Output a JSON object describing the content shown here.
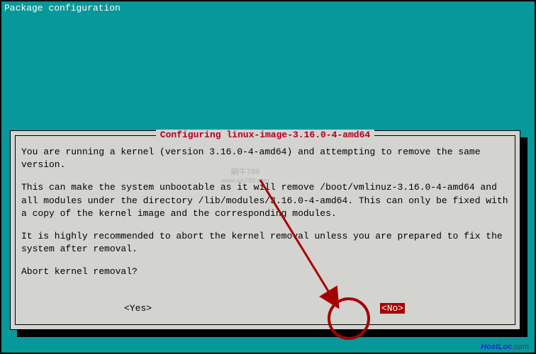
{
  "header": {
    "title": "Package configuration"
  },
  "dialog": {
    "title": "Configuring linux-image-3.16.0-4-amd64",
    "paragraphs": {
      "p1": "You are running a kernel (version 3.16.0-4-amd64) and attempting to remove the same version.",
      "p2": "This can make the system unbootable as it will remove /boot/vmlinuz-3.16.0-4-amd64 and all modules under the directory /lib/modules/3.16.0-4-amd64. This can only be fixed with a copy of the kernel image and the corresponding modules.",
      "p3": "It is highly recommended to abort the kernel removal unless you are prepared to fix the system after removal.",
      "prompt": "Abort kernel removal?"
    },
    "buttons": {
      "yes": "<Yes>",
      "no": "<No>"
    }
  },
  "watermark": {
    "line1": "蜗牛789",
    "line2": "www.wn789.com"
  },
  "footer": {
    "brand_left": "HostLoc",
    "brand_right": ".com"
  },
  "annotations": {
    "circle": "highlight-circle",
    "arrow": "highlight-arrow"
  }
}
